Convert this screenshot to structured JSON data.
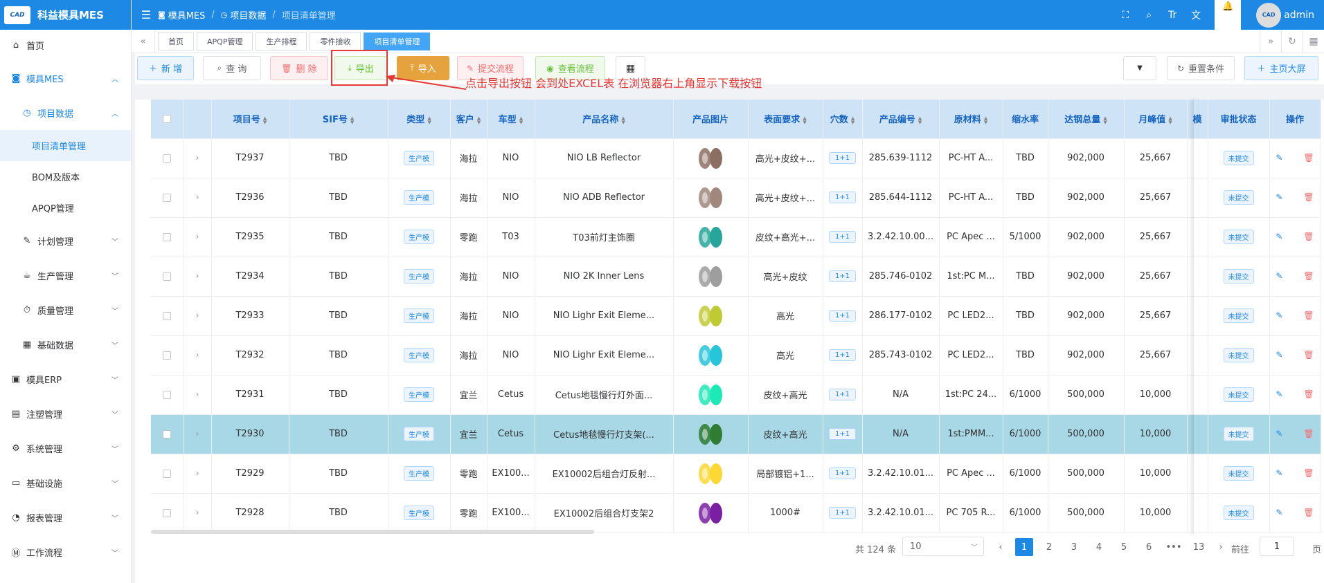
{
  "app": {
    "logo_badge": "CAD",
    "title": "科益模具MES",
    "user": "admin"
  },
  "header": {
    "breadcrumb": [
      "模具MES",
      "项目数据",
      "项目清单管理"
    ]
  },
  "sidebar": {
    "items": [
      {
        "label": "首页"
      },
      {
        "label": "模具MES"
      },
      {
        "label": "项目数据"
      },
      {
        "label": "项目清单管理"
      },
      {
        "label": "BOM及版本"
      },
      {
        "label": "APQP管理"
      },
      {
        "label": "计划管理"
      },
      {
        "label": "生产管理"
      },
      {
        "label": "质量管理"
      },
      {
        "label": "基础数据"
      },
      {
        "label": "模具ERP"
      },
      {
        "label": "注塑管理"
      },
      {
        "label": "系统管理"
      },
      {
        "label": "基础设施"
      },
      {
        "label": "报表管理"
      },
      {
        "label": "工作流程"
      }
    ]
  },
  "tabs": [
    "首页",
    "APQP管理",
    "生产排程",
    "零件接收",
    "项目清单管理"
  ],
  "toolbar": {
    "add": "新 增",
    "query": "查 询",
    "delete": "删 除",
    "export": "导出",
    "import": "导入",
    "submit_flow": "提交流程",
    "view_flow": "查看流程",
    "reset": "重置条件",
    "bigscreen": "主页大屏"
  },
  "annotation": "点击导出按钮 会到处EXCEL表  在浏览器右上角显示下载按钮",
  "table": {
    "headers": [
      "项目号",
      "SIF号",
      "类型",
      "客户",
      "车型",
      "产品名称",
      "产品图片",
      "表面要求",
      "穴数",
      "产品编号",
      "原材料",
      "缩水率",
      "达钢总量",
      "月峰值",
      "模",
      "审批状态",
      "操作"
    ],
    "rows": [
      {
        "no": "T2937",
        "sif": "TBD",
        "type": "生产模",
        "customer": "海拉",
        "car": "NIO",
        "product": "NIO LB Reflector",
        "surface": "高光+皮纹+...",
        "cavity": "1+1",
        "pno": "285.639-1112",
        "material": "PC-HT A...",
        "shrink": "TBD",
        "total": "902,000",
        "peak": "25,667",
        "status": "未提交"
      },
      {
        "no": "T2936",
        "sif": "TBD",
        "type": "生产模",
        "customer": "海拉",
        "car": "NIO",
        "product": "NIO ADB Reflector",
        "surface": "高光+皮纹+...",
        "cavity": "1+1",
        "pno": "285.644-1112",
        "material": "PC-HT A...",
        "shrink": "TBD",
        "total": "902,000",
        "peak": "25,667",
        "status": "未提交"
      },
      {
        "no": "T2935",
        "sif": "TBD",
        "type": "生产模",
        "customer": "零跑",
        "car": "T03",
        "product": "T03前灯主饰圈",
        "surface": "皮纹+高光+...",
        "cavity": "1+1",
        "pno": "3.2.42.10.00...",
        "material": "PC Apec ...",
        "shrink": "5/1000",
        "total": "902,000",
        "peak": "25,667",
        "status": "未提交"
      },
      {
        "no": "T2934",
        "sif": "TBD",
        "type": "生产模",
        "customer": "海拉",
        "car": "NIO",
        "product": "NIO 2K Inner Lens",
        "surface": "高光+皮纹",
        "cavity": "1+1",
        "pno": "285.746-0102",
        "material": "1st:PC M...",
        "shrink": "TBD",
        "total": "902,000",
        "peak": "25,667",
        "status": "未提交"
      },
      {
        "no": "T2933",
        "sif": "TBD",
        "type": "生产模",
        "customer": "海拉",
        "car": "NIO",
        "product": "NIO Lighr Exit Eleme...",
        "surface": "高光",
        "cavity": "1+1",
        "pno": "286.177-0102",
        "material": "PC LED2...",
        "shrink": "TBD",
        "total": "902,000",
        "peak": "25,667",
        "status": "未提交"
      },
      {
        "no": "T2932",
        "sif": "TBD",
        "type": "生产模",
        "customer": "海拉",
        "car": "NIO",
        "product": "NIO Lighr Exit Eleme...",
        "surface": "高光",
        "cavity": "1+1",
        "pno": "285.743-0102",
        "material": "PC LED2...",
        "shrink": "TBD",
        "total": "902,000",
        "peak": "25,667",
        "status": "未提交"
      },
      {
        "no": "T2931",
        "sif": "TBD",
        "type": "生产模",
        "customer": "宜兰",
        "car": "Cetus",
        "product": "Cetus地毯慢行灯外面...",
        "surface": "皮纹+高光",
        "cavity": "1+1",
        "pno": "N/A",
        "material": "1st:PC 24...",
        "shrink": "6/1000",
        "total": "500,000",
        "peak": "10,000",
        "status": "未提交"
      },
      {
        "no": "T2930",
        "sif": "TBD",
        "type": "生产模",
        "customer": "宜兰",
        "car": "Cetus",
        "product": "Cetus地毯慢行灯支架(...",
        "surface": "皮纹+高光",
        "cavity": "1+1",
        "pno": "N/A",
        "material": "1st:PMM...",
        "shrink": "6/1000",
        "total": "500,000",
        "peak": "10,000",
        "status": "未提交"
      },
      {
        "no": "T2929",
        "sif": "TBD",
        "type": "生产模",
        "customer": "零跑",
        "car": "EX100...",
        "product": "EX10002后组合灯反射...",
        "surface": "局部镀铝+1...",
        "cavity": "1+1",
        "pno": "3.2.42.10.01...",
        "material": "PC Apec ...",
        "shrink": "6/1000",
        "total": "500,000",
        "peak": "10,000",
        "status": "未提交"
      },
      {
        "no": "T2928",
        "sif": "TBD",
        "type": "生产模",
        "customer": "零跑",
        "car": "EX100...",
        "product": "EX10002后组合灯支架2",
        "surface": "1000#",
        "cavity": "1+1",
        "pno": "3.2.42.10.01...",
        "material": "PC 705 R...",
        "shrink": "6/1000",
        "total": "500,000",
        "peak": "10,000",
        "status": "未提交"
      }
    ]
  },
  "pagination": {
    "total": "共 124 条",
    "page_size": "10",
    "pages": [
      "1",
      "2",
      "3",
      "4",
      "5",
      "6",
      "•••",
      "13"
    ],
    "current": "1",
    "goto_label": "前往",
    "page_label": "页",
    "goto_value": "1"
  }
}
